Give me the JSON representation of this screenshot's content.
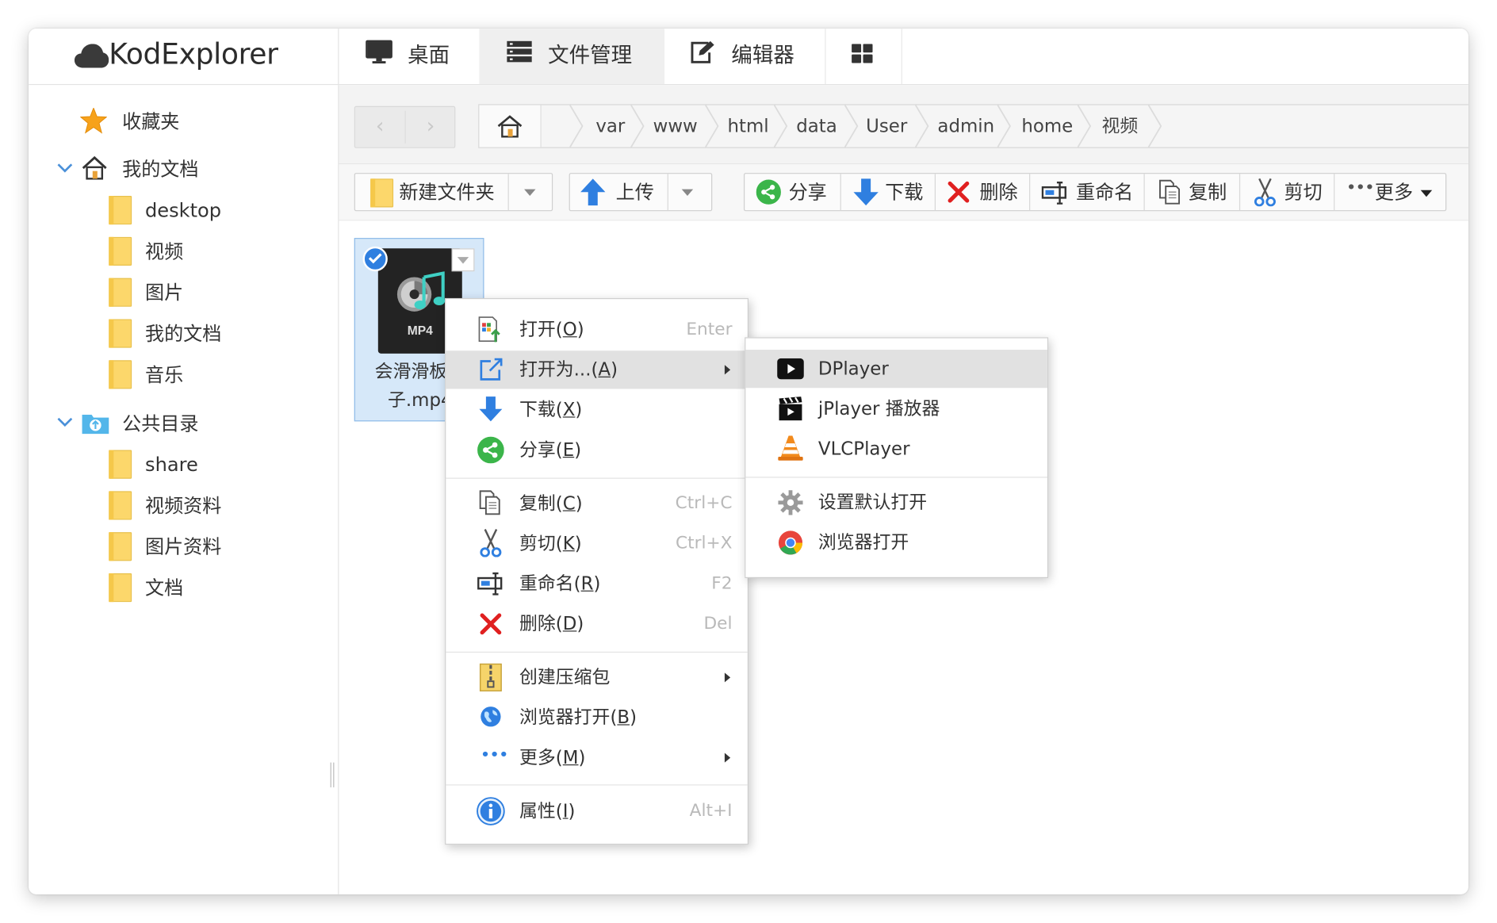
{
  "app": {
    "logo_text": "KodExplorer"
  },
  "nav": {
    "tabs": [
      {
        "label": "桌面"
      },
      {
        "label": "文件管理"
      },
      {
        "label": "编辑器"
      },
      {
        "label": ""
      }
    ]
  },
  "sidebar": {
    "favorites_label": "收藏夹",
    "my_docs_label": "我的文档",
    "my_docs_children": [
      "desktop",
      "视频",
      "图片",
      "我的文档",
      "音乐"
    ],
    "public_label": "公共目录",
    "public_children": [
      "share",
      "视频资料",
      "图片资料",
      "文档"
    ]
  },
  "breadcrumb": [
    "var",
    "www",
    "html",
    "data",
    "User",
    "admin",
    "home",
    "视频"
  ],
  "toolbar": {
    "new_folder": "新建文件夹",
    "upload": "上传",
    "share": "分享",
    "download": "下载",
    "delete": "删除",
    "rename": "重命名",
    "copy": "复制",
    "cut": "剪切",
    "more": "更多"
  },
  "file": {
    "name": "会滑滑板的狗子.mp4",
    "name_line1": "会滑滑板的",
    "name_line2": "子.mp4",
    "thumb_badge": "MP4"
  },
  "context_menu": {
    "items": [
      {
        "label": "打开",
        "accel": "O",
        "shortcut": "Enter"
      },
      {
        "label": "打开为...",
        "accel": "A",
        "shortcut": ""
      },
      {
        "label": "下载",
        "accel": "X",
        "shortcut": ""
      },
      {
        "label": "分享",
        "accel": "E",
        "shortcut": ""
      },
      {
        "label": "复制",
        "accel": "C",
        "shortcut": "Ctrl+C"
      },
      {
        "label": "剪切",
        "accel": "K",
        "shortcut": "Ctrl+X"
      },
      {
        "label": "重命名",
        "accel": "R",
        "shortcut": "F2"
      },
      {
        "label": "删除",
        "accel": "D",
        "shortcut": "Del"
      },
      {
        "label": "创建压缩包",
        "accel": "",
        "shortcut": ""
      },
      {
        "label": "浏览器打开",
        "accel": "B",
        "shortcut": ""
      },
      {
        "label": "更多",
        "accel": "M",
        "shortcut": ""
      },
      {
        "label": "属性",
        "accel": "I",
        "shortcut": "Alt+I"
      }
    ]
  },
  "submenu": {
    "items": [
      {
        "label": "DPlayer"
      },
      {
        "label": "jPlayer 播放器"
      },
      {
        "label": "VLCPlayer"
      },
      {
        "label": "设置默认打开"
      },
      {
        "label": "浏览器打开"
      }
    ]
  },
  "colors": {
    "accent_blue": "#2f7fe0",
    "folder_yellow": "#fcd76b",
    "selection_bg": "#d6e8f9",
    "menu_highlight": "#e1e1e1",
    "delete_red": "#e02020",
    "share_green": "#3bb54a"
  }
}
